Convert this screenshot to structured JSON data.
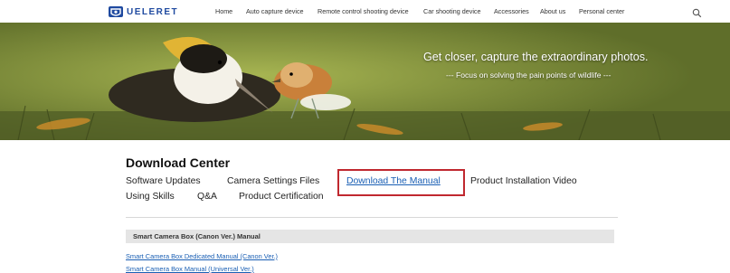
{
  "header": {
    "logo_text": "UELERET",
    "nav": [
      "Home",
      "Auto capture device",
      "Remote control shooting device",
      "Car shooting device",
      "Accessories",
      "About us",
      "Personal center"
    ]
  },
  "banner": {
    "title": "Get closer, capture the extraordinary photos.",
    "subtitle": "--- Focus on solving the pain points of wildlife ---"
  },
  "download_center": {
    "title": "Download Center",
    "tabs": [
      {
        "label": "Software Updates",
        "active": false
      },
      {
        "label": "Camera Settings Files",
        "active": false
      },
      {
        "label": "Download The Manual",
        "active": true
      },
      {
        "label": "Product Installation Video",
        "active": false
      },
      {
        "label": "Using Skills",
        "active": false
      },
      {
        "label": "Q&A",
        "active": false
      },
      {
        "label": "Product Certification",
        "active": false
      }
    ],
    "section_title": "Smart Camera Box (Canon Ver.) Manual",
    "links": [
      "Smart Camera Box Dedicated Manual (Canon Ver.)",
      "Smart Camera Box Manual (Universal Ver.)"
    ]
  },
  "colors": {
    "brand": "#1f4aa0",
    "link": "#1a5fb4",
    "highlight_border": "#c0282f"
  }
}
